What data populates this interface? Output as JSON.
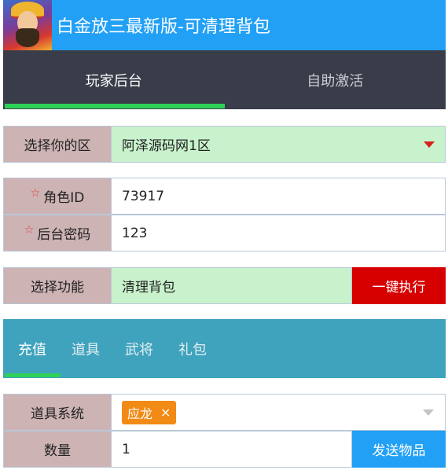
{
  "header": {
    "title": "白金放三最新版-可清理背包"
  },
  "main_tabs": [
    {
      "label": "玩家后台",
      "active": true
    },
    {
      "label": "自助激活",
      "active": false
    }
  ],
  "server": {
    "label": "选择你的区",
    "value": "阿泽源码网1区"
  },
  "role_id": {
    "label": "角色ID",
    "value": "73917"
  },
  "password": {
    "label": "后台密码",
    "value": "123"
  },
  "function": {
    "label": "选择功能",
    "value": "清理背包",
    "button": "一键执行"
  },
  "sub_tabs": [
    {
      "label": "充值",
      "active": true
    },
    {
      "label": "道具",
      "active": false
    },
    {
      "label": "武将",
      "active": false
    },
    {
      "label": "礼包",
      "active": false
    }
  ],
  "item_system": {
    "label": "道具系统",
    "tag": "应龙",
    "tag_close": "×"
  },
  "quantity": {
    "label": "数量",
    "value": "1",
    "button": "发送物品"
  },
  "required_mark": "☆",
  "colors": {
    "header": "#22a0f5",
    "nav": "#393d49",
    "accent": "#2ed158",
    "subnav": "#40a3bd",
    "execute": "#d60000",
    "tag": "#f28a16"
  }
}
